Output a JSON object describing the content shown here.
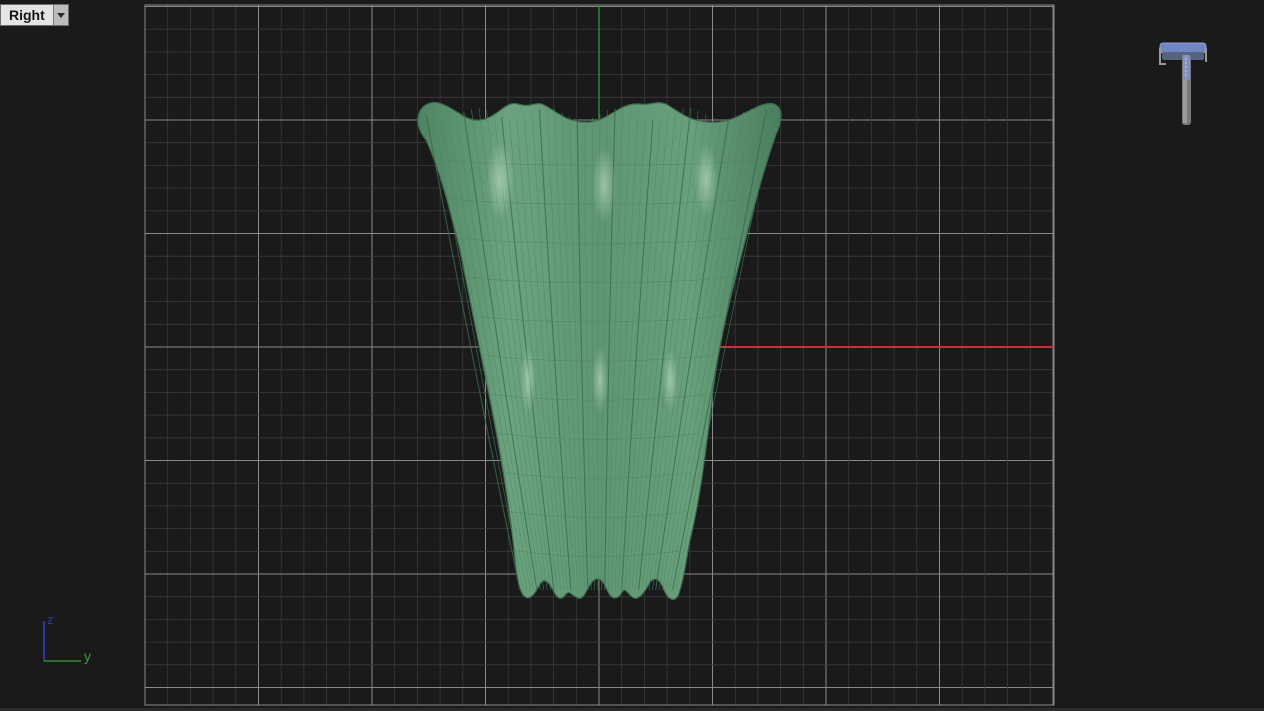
{
  "viewport": {
    "view_name": "Right",
    "axis_labels": {
      "vertical": "z",
      "horizontal": "y"
    }
  },
  "icons": {
    "view_dropdown": "chevron-down-icon",
    "nav_widget": "view-navigation-widget-icon",
    "axis_triad": "axis-triad-icon"
  },
  "colors": {
    "background": "#1a1a1a",
    "grid_minor": "#3a3a3a",
    "grid_major": "#8a8a8a",
    "axis_x": "#c8322a",
    "axis_y": "#2a8a2a",
    "model_fill": "#5f9772",
    "model_lines": "#3f6e52",
    "triad_blue": "#2a3aa0",
    "triad_green": "#2f8a2f"
  }
}
